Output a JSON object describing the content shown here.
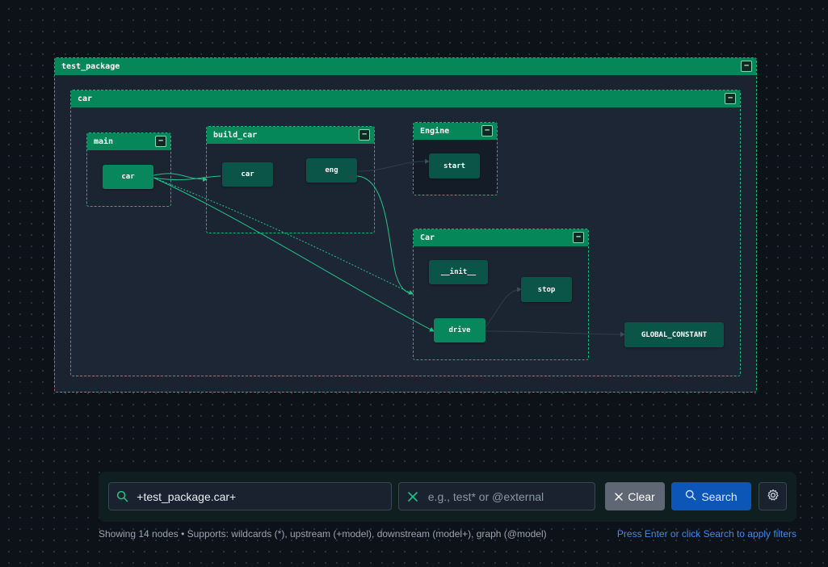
{
  "graph": {
    "groups": {
      "test_package": "test_package",
      "car": "car",
      "main": "main",
      "build_car": "build_car",
      "engine": "Engine",
      "car_class": "Car"
    },
    "collapse_symbol": "−",
    "nodes": {
      "main_car": "car",
      "build_car_car": "car",
      "eng": "eng",
      "start": "start",
      "init": "__init__",
      "stop": "stop",
      "drive": "drive",
      "global_constant": "GLOBAL_CONSTANT"
    }
  },
  "filter_bar": {
    "search_value": "+test_package.car+",
    "exclude_placeholder": "e.g., test* or @external",
    "clear_label": "Clear",
    "search_label": "Search"
  },
  "footer": {
    "info": "Showing 14 nodes • Supports: wildcards (*), upstream (+model), downstream (model+), graph (@model)",
    "hint": "Press Enter or click Search to apply filters"
  },
  "colors": {
    "background": "#0d1219",
    "group_header": "#06875a",
    "group_border": "#16b87a",
    "node_dark": "#0a5448",
    "node_green": "#08865c",
    "search_button": "#0c56b8",
    "hint_link": "#3d8bf2"
  },
  "icons": {
    "search": "search-icon",
    "exclude": "x-icon",
    "clear": "close-icon",
    "settings": "gear-icon"
  }
}
